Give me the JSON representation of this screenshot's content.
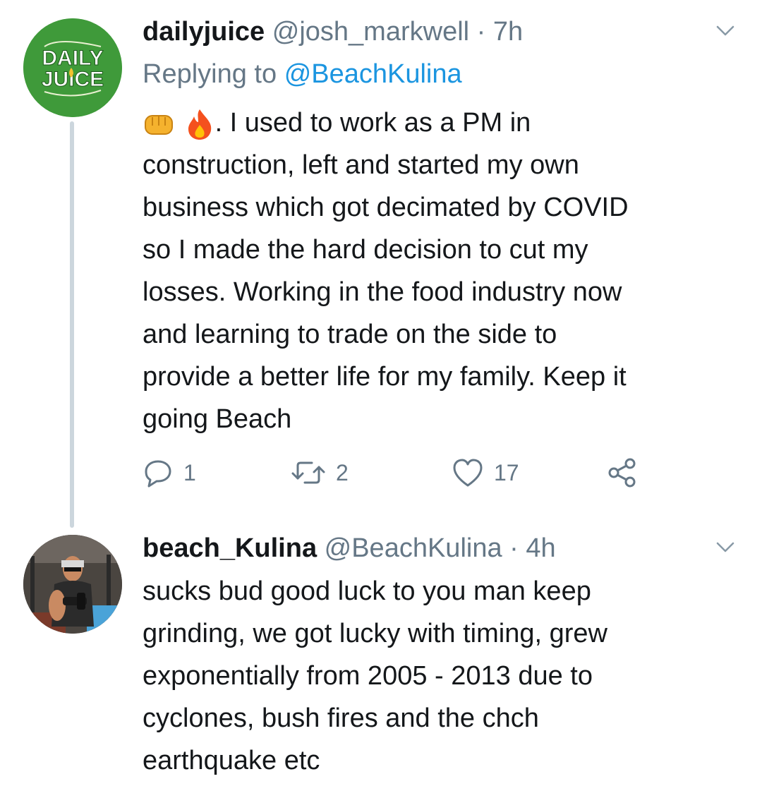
{
  "tweets": [
    {
      "display_name": "dailyjuice",
      "handle": "@josh_markwell",
      "separator": "·",
      "time": "7h",
      "replying_prefix": "Replying to",
      "replying_to": "@BeachKulina",
      "avatar_text": [
        "DAILY",
        "JUICE"
      ],
      "body_lines": [
        ". I used to work as a PM in",
        "construction, left and started my own",
        "business which got decimated by COVID",
        "so I made the hard decision to cut my",
        "losses. Working in the food industry now",
        "and learning to trade on the side to",
        "provide a better life for my family. Keep it",
        "going Beach"
      ],
      "emojis": [
        "fist-emoji",
        "fire-emoji"
      ],
      "actions": {
        "reply_count": "1",
        "retweet_count": "2",
        "like_count": "17"
      }
    },
    {
      "display_name": "beach_Kulina",
      "handle": "@BeachKulina",
      "separator": "·",
      "time": "4h",
      "body_lines": [
        "sucks bud good luck to you man keep",
        "grinding, we got lucky with timing, grew",
        "exponentially from 2005 - 2013 due to",
        "cyclones, bush fires and the chch",
        "earthquake etc"
      ]
    }
  ],
  "colors": {
    "name": "#14171a",
    "meta": "#657786",
    "mention": "#1b95e0",
    "thread_line": "#ccd6dd",
    "avatar_green": "#3f9a3a"
  }
}
